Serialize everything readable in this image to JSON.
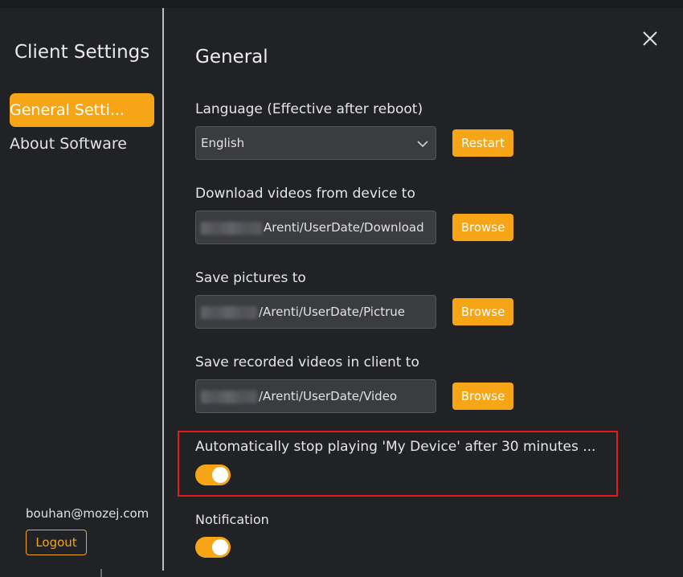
{
  "sidebar": {
    "title": "Client Settings",
    "items": [
      {
        "label": "General Setti..."
      },
      {
        "label": "About Software"
      }
    ],
    "email": "bouhan@mozej.com",
    "logout_label": "Logout"
  },
  "main": {
    "section_title": "General",
    "language": {
      "label": "Language (Effective after reboot)",
      "value": "English",
      "button": "Restart"
    },
    "download_videos": {
      "label": "Download videos from device to",
      "path": "Arenti/UserDate/Download",
      "button": "Browse"
    },
    "save_pictures": {
      "label": "Save pictures to",
      "path": "/Arenti/UserDate/Pictrue",
      "button": "Browse"
    },
    "save_recorded": {
      "label": "Save recorded videos in client to",
      "path": "/Arenti/UserDate/Video",
      "button": "Browse"
    },
    "auto_stop": {
      "label": "Automatically stop playing 'My Device' after 30 minutes ...",
      "enabled": true
    },
    "notification": {
      "label": "Notification",
      "enabled": true
    }
  },
  "colors": {
    "accent": "#f5a515",
    "background": "#212226",
    "highlight": "#e31b1b"
  }
}
